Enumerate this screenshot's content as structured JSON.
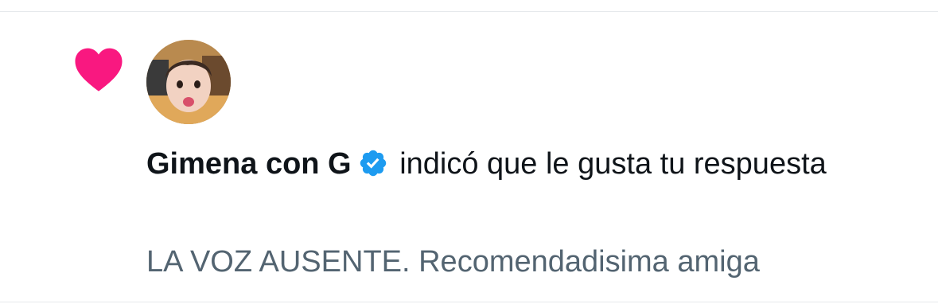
{
  "notification": {
    "user_name": "Gimena con G",
    "action_text": "indicó que le gusta tu respuesta",
    "reply_preview": "LA VOZ AUSENTE. Recomendadisima amiga",
    "verified": true
  },
  "icons": {
    "notification_type": "heart-icon",
    "badge": "verified-icon"
  },
  "colors": {
    "heart": "#f91880",
    "verified": "#1d9bf0",
    "primary_text": "#0f1419",
    "secondary_text": "#536471",
    "divider": "#e6e9ec"
  }
}
